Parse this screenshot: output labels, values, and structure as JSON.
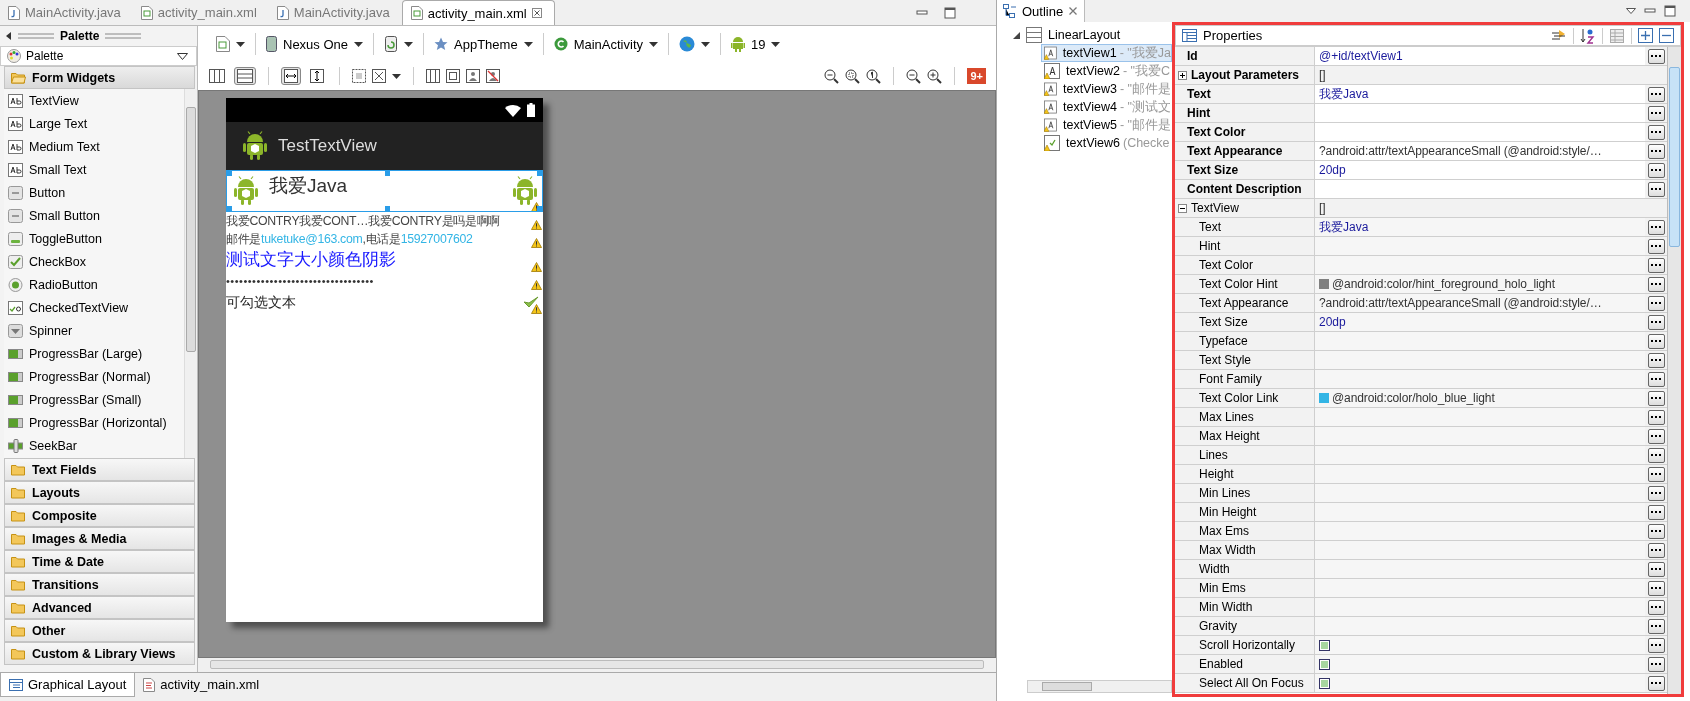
{
  "editor_tabs": [
    {
      "label": "MainActivity.java",
      "kind": "java",
      "selected": false
    },
    {
      "label": "activity_main.xml",
      "kind": "xml",
      "selected": false
    },
    {
      "label": "MainActivity.java",
      "kind": "java",
      "selected": false
    },
    {
      "label": "activity_main.xml",
      "kind": "xml",
      "selected": true
    }
  ],
  "palette": {
    "title": "Palette",
    "dropdown": "Palette",
    "categories": [
      {
        "label": "Form Widgets",
        "expanded": true,
        "items": [
          {
            "label": "TextView",
            "kind": "text"
          },
          {
            "label": "Large Text",
            "kind": "text"
          },
          {
            "label": "Medium Text",
            "kind": "text"
          },
          {
            "label": "Small Text",
            "kind": "text"
          },
          {
            "label": "Button",
            "kind": "button"
          },
          {
            "label": "Small Button",
            "kind": "button"
          },
          {
            "label": "ToggleButton",
            "kind": "toggle"
          },
          {
            "label": "CheckBox",
            "kind": "check"
          },
          {
            "label": "RadioButton",
            "kind": "radio"
          },
          {
            "label": "CheckedTextView",
            "kind": "checkedtext"
          },
          {
            "label": "Spinner",
            "kind": "spinner"
          },
          {
            "label": "ProgressBar (Large)",
            "kind": "progress"
          },
          {
            "label": "ProgressBar (Normal)",
            "kind": "progress"
          },
          {
            "label": "ProgressBar (Small)",
            "kind": "progress"
          },
          {
            "label": "ProgressBar (Horizontal)",
            "kind": "progress"
          },
          {
            "label": "SeekBar",
            "kind": "seek"
          }
        ]
      },
      {
        "label": "Text Fields",
        "expanded": false
      },
      {
        "label": "Layouts",
        "expanded": false
      },
      {
        "label": "Composite",
        "expanded": false
      },
      {
        "label": "Images & Media",
        "expanded": false
      },
      {
        "label": "Time & Date",
        "expanded": false
      },
      {
        "label": "Transitions",
        "expanded": false
      },
      {
        "label": "Advanced",
        "expanded": false
      },
      {
        "label": "Other",
        "expanded": false
      },
      {
        "label": "Custom & Library Views",
        "expanded": false
      }
    ]
  },
  "toolbar": {
    "config_items": [
      {
        "kind": "layout"
      },
      {
        "kind": "device",
        "label": "Nexus One"
      },
      {
        "kind": "rotate"
      },
      {
        "kind": "theme",
        "label": "AppTheme"
      },
      {
        "kind": "activity",
        "label": "MainActivity"
      },
      {
        "kind": "locale"
      },
      {
        "kind": "api",
        "label": "19"
      }
    ],
    "view_toggles": [
      {
        "selected": false
      },
      {
        "selected": true
      }
    ],
    "fit_toggles": [
      {
        "selected": true
      },
      {
        "selected": false
      }
    ],
    "badge": "9+"
  },
  "phone": {
    "app_title": "TestTextView",
    "views": [
      {
        "kind": "icon_text",
        "text": "我爱Java",
        "selected": true,
        "warning": true
      },
      {
        "kind": "plain",
        "text": "我爱CONTRY我爱CONT…我爱CONTRY是吗是啊啊",
        "warning": true
      },
      {
        "kind": "rich",
        "parts": [
          {
            "text": "邮件是",
            "kind": "text"
          },
          {
            "text": "tuketuke@163.com",
            "kind": "link"
          },
          {
            "text": ",电话是",
            "kind": "text"
          },
          {
            "text": "15927007602",
            "kind": "link"
          }
        ],
        "warning": true
      },
      {
        "kind": "large",
        "text": "测试文字大小颜色阴影",
        "warning": true
      },
      {
        "kind": "marquee",
        "text": "••••••••••••••••••••••••••••••••••",
        "warning": true
      },
      {
        "kind": "checked",
        "text": "可勾选文本",
        "checked": true,
        "warning": true
      }
    ]
  },
  "outline": {
    "tab": "Outline",
    "root": {
      "label": "LinearLayout",
      "expanded": true,
      "children": [
        {
          "id": "textView1",
          "detail": " - \"我爱Ja",
          "kind": "text",
          "selected": true
        },
        {
          "id": "textView2",
          "detail": " - \"我爱C",
          "kind": "text",
          "selected": false
        },
        {
          "id": "textView3",
          "detail": " - \"邮件是",
          "kind": "text",
          "selected": false
        },
        {
          "id": "textView4",
          "detail": " - \"测试文",
          "kind": "text",
          "selected": false
        },
        {
          "id": "textView5",
          "detail": " - \"邮件是",
          "kind": "text",
          "selected": false
        },
        {
          "id": "textView6",
          "detail": " (Checke",
          "kind": "checked",
          "selected": false
        }
      ]
    }
  },
  "properties": {
    "title": "Properties",
    "rows": [
      {
        "name": "Id",
        "kind": "main",
        "value": "@+id/textView1",
        "literal": true
      },
      {
        "name": "Layout Parameters",
        "kind": "group",
        "bold": true,
        "expanded": false,
        "value": "[]",
        "literal": false
      },
      {
        "name": "Text",
        "kind": "main",
        "value": "我爱Java",
        "literal": true
      },
      {
        "name": "Hint",
        "kind": "main"
      },
      {
        "name": "Text Color",
        "kind": "main"
      },
      {
        "name": "Text Appearance",
        "kind": "main",
        "value": "?android:attr/textAppearanceSmall (@android:style/…",
        "literal": false
      },
      {
        "name": "Text Size",
        "kind": "main",
        "value": "20dp",
        "literal": true
      },
      {
        "name": "Content Description",
        "kind": "main"
      },
      {
        "name": "TextView",
        "kind": "group",
        "bold": false,
        "expanded": true,
        "value": "[]",
        "literal": false,
        "children": [
          {
            "name": "Text",
            "kind": "prop",
            "value": "我爱Java",
            "literal": true
          },
          {
            "name": "Hint",
            "kind": "prop"
          },
          {
            "name": "Text Color",
            "kind": "prop"
          },
          {
            "name": "Text Color Hint",
            "kind": "prop",
            "value": "@android:color/hint_foreground_holo_light",
            "literal": false,
            "color": "#808080"
          },
          {
            "name": "Text Appearance",
            "kind": "prop",
            "value": "?android:attr/textAppearanceSmall (@android:style/…",
            "literal": false
          },
          {
            "name": "Text Size",
            "kind": "prop",
            "value": "20dp",
            "literal": true
          },
          {
            "name": "Typeface",
            "kind": "prop"
          },
          {
            "name": "Text Style",
            "kind": "prop"
          },
          {
            "name": "Font Family",
            "kind": "prop"
          },
          {
            "name": "Text Color Link",
            "kind": "prop",
            "value": "@android:color/holo_blue_light",
            "literal": false,
            "color": "#33b5e5"
          },
          {
            "name": "Max Lines",
            "kind": "prop"
          },
          {
            "name": "Max Height",
            "kind": "prop"
          },
          {
            "name": "Lines",
            "kind": "prop"
          },
          {
            "name": "Height",
            "kind": "prop"
          },
          {
            "name": "Min Lines",
            "kind": "prop"
          },
          {
            "name": "Min Height",
            "kind": "prop"
          },
          {
            "name": "Max Ems",
            "kind": "prop"
          },
          {
            "name": "Max Width",
            "kind": "prop"
          },
          {
            "name": "Width",
            "kind": "prop"
          },
          {
            "name": "Min Ems",
            "kind": "prop"
          },
          {
            "name": "Min Width",
            "kind": "prop"
          },
          {
            "name": "Gravity",
            "kind": "prop"
          },
          {
            "name": "Scroll Horizontally",
            "kind": "prop",
            "checked": true
          },
          {
            "name": "Enabled",
            "kind": "prop",
            "checked": true
          },
          {
            "name": "Select All On Focus",
            "kind": "prop",
            "checked": true
          }
        ]
      }
    ]
  },
  "bottom_tabs": [
    {
      "label": "Graphical Layout",
      "kind": "layout",
      "selected": true
    },
    {
      "label": "activity_main.xml",
      "kind": "xml",
      "selected": false
    }
  ]
}
